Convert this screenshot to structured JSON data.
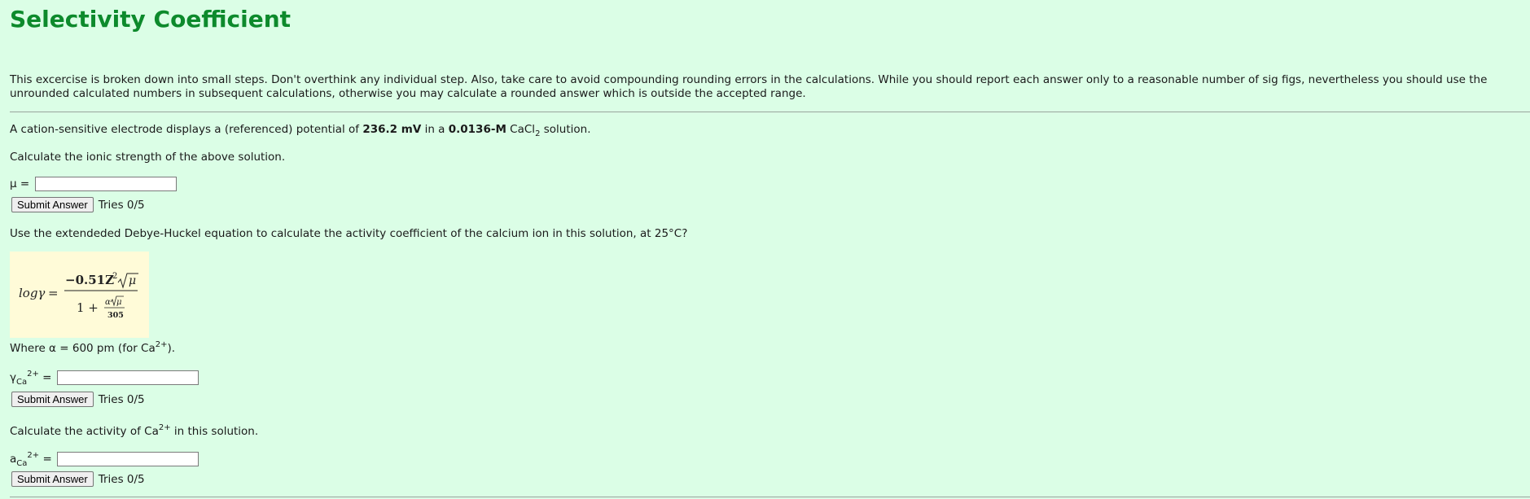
{
  "title": "Selectivity Coefficient",
  "intro": "This excercise is broken down into small steps. Don't overthink any individual step. Also, take care to avoid compounding rounding errors in the calculations. While you should report each answer only to a reasonable number of sig figs, nevertheless you should use the unrounded calculated numbers in subsequent calculations, otherwise you may calculate a rounded answer which is outside the accepted range.",
  "problem": {
    "prefix": "A cation-sensitive electrode displays a (referenced) potential of ",
    "potential": "236.2 mV",
    "mid": " in a ",
    "concentration": "0.0136-M",
    "salt_base": " CaCl",
    "salt_sub": "2",
    "suffix": " solution."
  },
  "q1": {
    "prompt": "Calculate the ionic strength of the above solution.",
    "label": "μ =",
    "value": "",
    "submit": "Submit Answer",
    "tries": "Tries 0/5"
  },
  "q2": {
    "prompt": "Use the extendeded Debye-Huckel equation to calculate the activity coefficient of the calcium ion in this solution, at 25°C?",
    "formula": {
      "lhs": "logγ",
      "equals": "=",
      "numerator": "−0.51Z",
      "num_sup": "2",
      "sqrt_arg": "μ",
      "one_plus": "1 +",
      "alpha": "α",
      "den_sqrt_arg": "μ",
      "den_value": "305"
    },
    "where_prefix": "Where α = 600 pm (for Ca",
    "where_sup": "2+",
    "where_suffix": ").",
    "label_base": "γ",
    "label_sub": "Ca",
    "label_sup": "2+",
    "label_eq": " =",
    "value": "",
    "submit": "Submit Answer",
    "tries": "Tries 0/5"
  },
  "q3": {
    "prompt_prefix": "Calculate the activity of Ca",
    "prompt_sup": "2+",
    "prompt_suffix": " in this solution.",
    "label_base": "a",
    "label_sub": "Ca",
    "label_sup": "2+",
    "label_eq": " =",
    "value": "",
    "submit": "Submit Answer",
    "tries": "Tries 0/5"
  }
}
